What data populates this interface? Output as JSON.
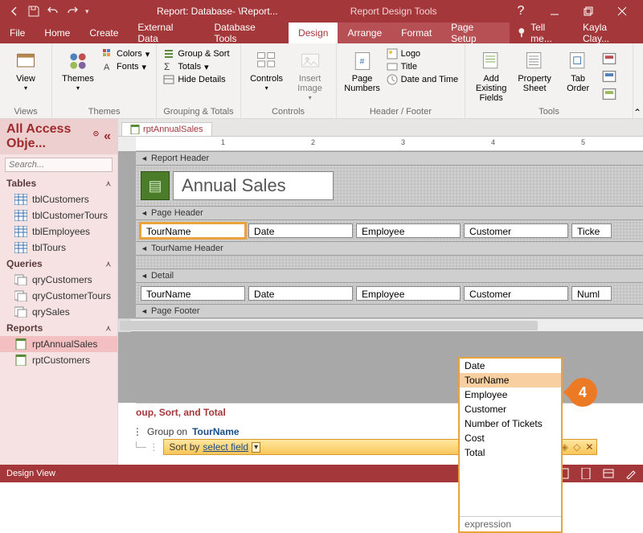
{
  "titlebar": {
    "title": "Report: Database- \\Report...",
    "contextual": "Report Design Tools"
  },
  "tabs": {
    "file": "File",
    "home": "Home",
    "create": "Create",
    "external": "External Data",
    "dbtools": "Database Tools",
    "design": "Design",
    "arrange": "Arrange",
    "format": "Format",
    "pagesetup": "Page Setup",
    "tellme": "Tell me...",
    "user": "Kayla Clay..."
  },
  "ribbon": {
    "views": {
      "label": "Views",
      "view": "View"
    },
    "themes": {
      "label": "Themes",
      "themes": "Themes",
      "colors": "Colors",
      "fonts": "Fonts"
    },
    "grouping": {
      "label": "Grouping & Totals",
      "groupsort": "Group & Sort",
      "totals": "Totals",
      "hide": "Hide Details"
    },
    "controls": {
      "label": "Controls",
      "controls": "Controls",
      "insertimg": "Insert Image"
    },
    "headerfooter": {
      "label": "Header / Footer",
      "logo": "Logo",
      "title": "Title",
      "datetime": "Date and Time",
      "pagenumbers": "Page Numbers"
    },
    "tools": {
      "label": "Tools",
      "addfields": "Add Existing Fields",
      "propsheet": "Property Sheet",
      "taborder": "Tab Order"
    }
  },
  "nav": {
    "header": "All Access Obje...",
    "search_placeholder": "Search...",
    "groups": {
      "tables": {
        "label": "Tables",
        "items": [
          "tblCustomers",
          "tblCustomerTours",
          "tblEmployees",
          "tblTours"
        ]
      },
      "queries": {
        "label": "Queries",
        "items": [
          "qryCustomers",
          "qryCustomerTours",
          "qrySales"
        ]
      },
      "reports": {
        "label": "Reports",
        "items": [
          "rptAnnualSales",
          "rptCustomers"
        ]
      }
    }
  },
  "doc": {
    "tab": "rptAnnualSales"
  },
  "ruler": {
    "marks": [
      "1",
      "2",
      "3",
      "4",
      "5"
    ]
  },
  "sections": {
    "reporthdr": "Report Header",
    "pagehdr": "Page Header",
    "tournamehdr": "TourName Header",
    "detail": "Detail",
    "pagefooter": "Page Footer"
  },
  "report": {
    "title": "Annual Sales",
    "page_headers": [
      "TourName",
      "Date",
      "Employee",
      "Customer",
      "Ticke"
    ],
    "detail_fields": [
      "TourName",
      "Date",
      "Employee",
      "Customer",
      "Numl"
    ]
  },
  "gst": {
    "title": "Group, Sort, and Total",
    "group_on_label": "Group on",
    "group_on_field": "TourName",
    "sort_by_label": "Sort by",
    "sort_by_value": "select field"
  },
  "popup": {
    "items": [
      "Date",
      "TourName",
      "Employee",
      "Customer",
      "Number of Tickets",
      "Cost",
      "Total"
    ],
    "highlight_index": 1,
    "footer": "expression"
  },
  "callout": {
    "num": "4"
  },
  "status": {
    "text": "Design View"
  }
}
